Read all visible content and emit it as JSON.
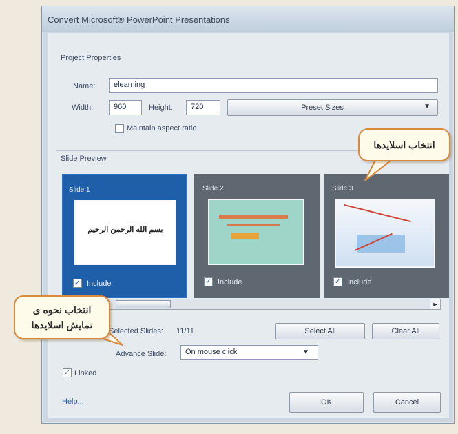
{
  "window": {
    "title": "Convert Microsoft® PowerPoint Presentations"
  },
  "project": {
    "section_label": "Project Properties",
    "name_label": "Name:",
    "name_value": "elearning",
    "width_label": "Width:",
    "width_value": "960",
    "height_label": "Height:",
    "height_value": "720",
    "preset_label": "Preset Sizes",
    "aspect_label": "Maintain aspect ratio"
  },
  "preview": {
    "section_label": "Slide Preview",
    "slides": [
      {
        "title": "Slide 1",
        "thumb_text": "بسم الله الرحمن الرحيم",
        "include_label": "Include",
        "selected": true
      },
      {
        "title": "Slide 2",
        "thumb_text": "",
        "include_label": "Include",
        "selected": false
      },
      {
        "title": "Slide 3",
        "thumb_text": "",
        "include_label": "Include",
        "selected": false
      }
    ]
  },
  "selection": {
    "selected_label": "Selected Slides:",
    "selected_value": "11/11",
    "select_all": "Select All",
    "clear_all": "Clear All",
    "advance_label": "Advance Slide:",
    "advance_value": "On mouse click"
  },
  "linked_label": "Linked",
  "footer": {
    "help": "Help...",
    "ok": "OK",
    "cancel": "Cancel"
  },
  "callouts": {
    "slides": "انتخاب اسلایدها",
    "display_line1": "انتخاب نحوه ی",
    "display_line2": "نمایش اسلایدها"
  },
  "colors": {
    "selected_card": "#1f5ea8",
    "card": "#5f6770",
    "callout_border": "#d98a3a"
  }
}
